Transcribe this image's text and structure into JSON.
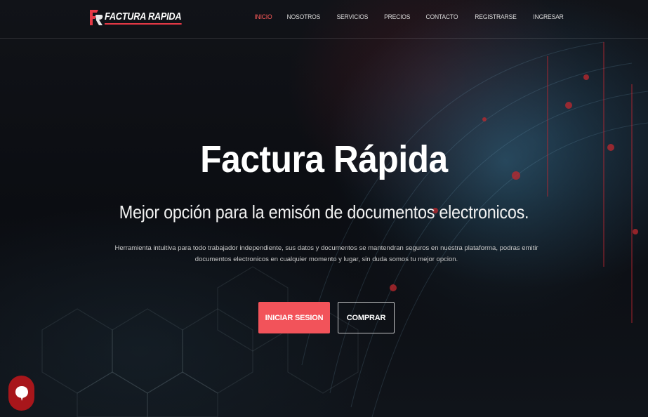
{
  "brand": {
    "logo_text": "FACTURA RAPIDA",
    "accent_color": "#e63946"
  },
  "nav": {
    "items": [
      {
        "label": "INICIO",
        "active": true
      },
      {
        "label": "NOSOTROS",
        "active": false
      },
      {
        "label": "SERVICIOS",
        "active": false
      },
      {
        "label": "PRECIOS",
        "active": false
      },
      {
        "label": "CONTACTO",
        "active": false
      },
      {
        "label": "REGISTRARSE",
        "active": false
      },
      {
        "label": "INGRESAR",
        "active": false
      }
    ]
  },
  "hero": {
    "title": "Factura Rápida",
    "subtitle": "Mejor opción para la emisón de documentos electronicos.",
    "description": "Herramienta intuitiva para todo trabajador independiente, sus datos y documentos se mantendran seguros en nuestra plataforma, podras emitir documentos electronicos en cualquier momento y lugar, sin duda somos tu mejor opcion.",
    "primary_button": "INICIAR SESION",
    "secondary_button": "COMPRAR",
    "primary_color": "#f2535a"
  },
  "chat": {
    "icon": "chat-bubble-icon",
    "color": "#a8161b"
  }
}
